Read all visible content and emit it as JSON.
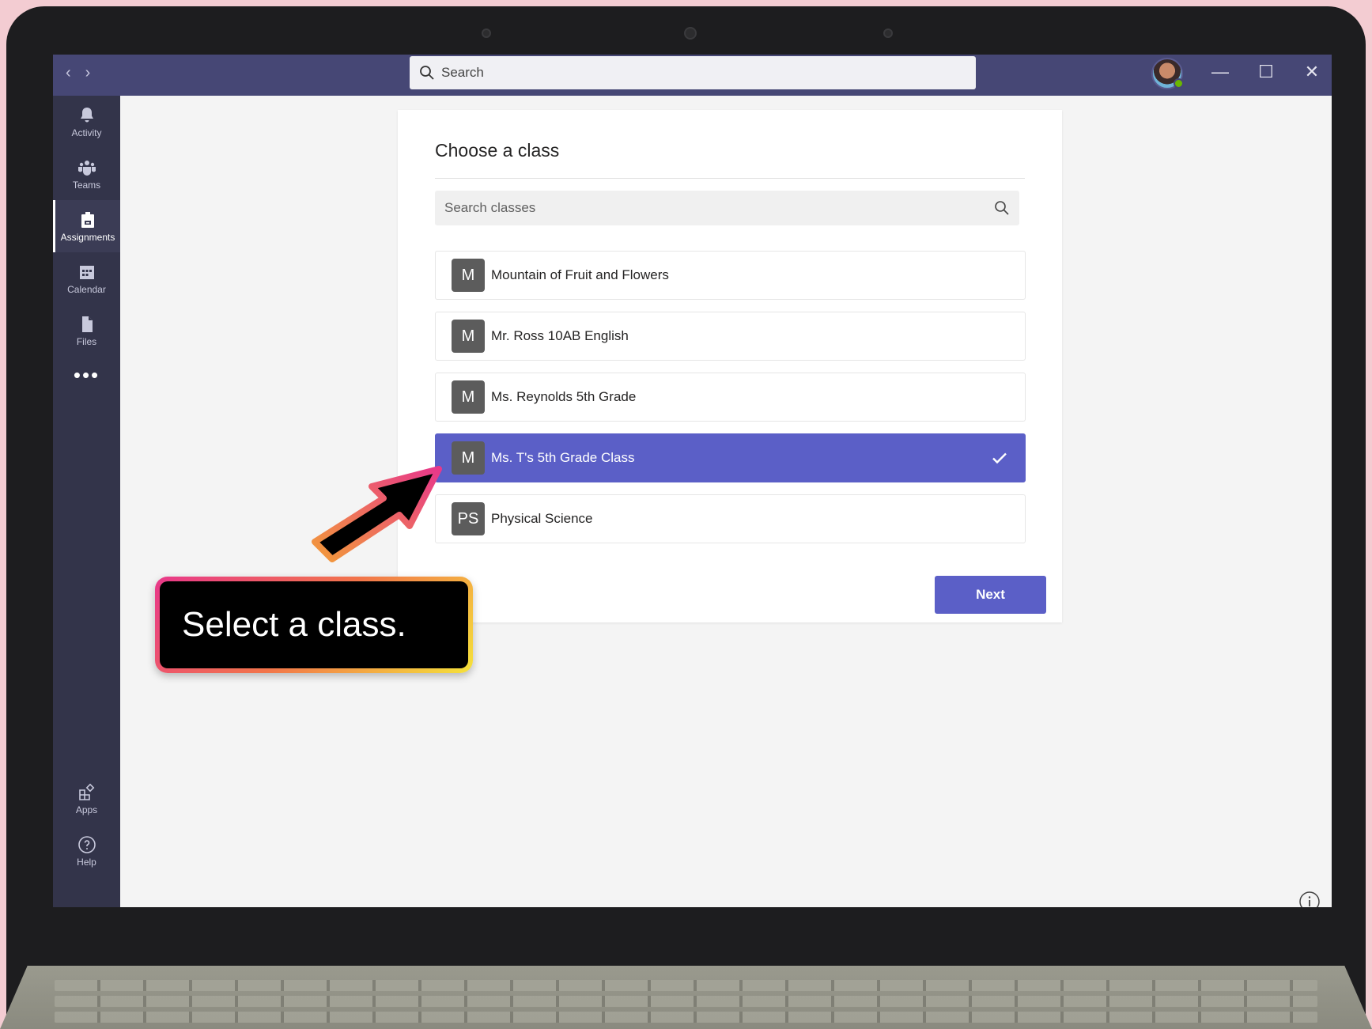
{
  "titlebar": {
    "search_placeholder": "Search",
    "nav_back": "‹",
    "nav_forward": "›",
    "minimize": "—",
    "maximize": "☐",
    "close": "✕"
  },
  "rail": {
    "items": [
      {
        "label": "Activity",
        "icon": "bell-icon"
      },
      {
        "label": "Teams",
        "icon": "teams-icon"
      },
      {
        "label": "Assignments",
        "icon": "assignments-icon"
      },
      {
        "label": "Calendar",
        "icon": "calendar-icon"
      },
      {
        "label": "Files",
        "icon": "files-icon"
      }
    ],
    "more": "•••",
    "apps": "Apps",
    "help": "Help"
  },
  "panel": {
    "title": "Choose a class",
    "search_placeholder": "Search classes",
    "classes": [
      {
        "initials": "M",
        "name": "Mountain of Fruit and Flowers",
        "selected": false
      },
      {
        "initials": "M",
        "name": "Mr. Ross 10AB English",
        "selected": false
      },
      {
        "initials": "M",
        "name": "Ms. Reynolds 5th Grade",
        "selected": false
      },
      {
        "initials": "M",
        "name": "Ms. T's 5th Grade Class",
        "selected": true
      },
      {
        "initials": "PS",
        "name": "Physical Science",
        "selected": false
      }
    ],
    "next_label": "Next"
  },
  "callout": {
    "text": "Select a class."
  },
  "colors": {
    "accent": "#5b5fc7",
    "titlebar": "#464775",
    "rail": "#33344a"
  }
}
